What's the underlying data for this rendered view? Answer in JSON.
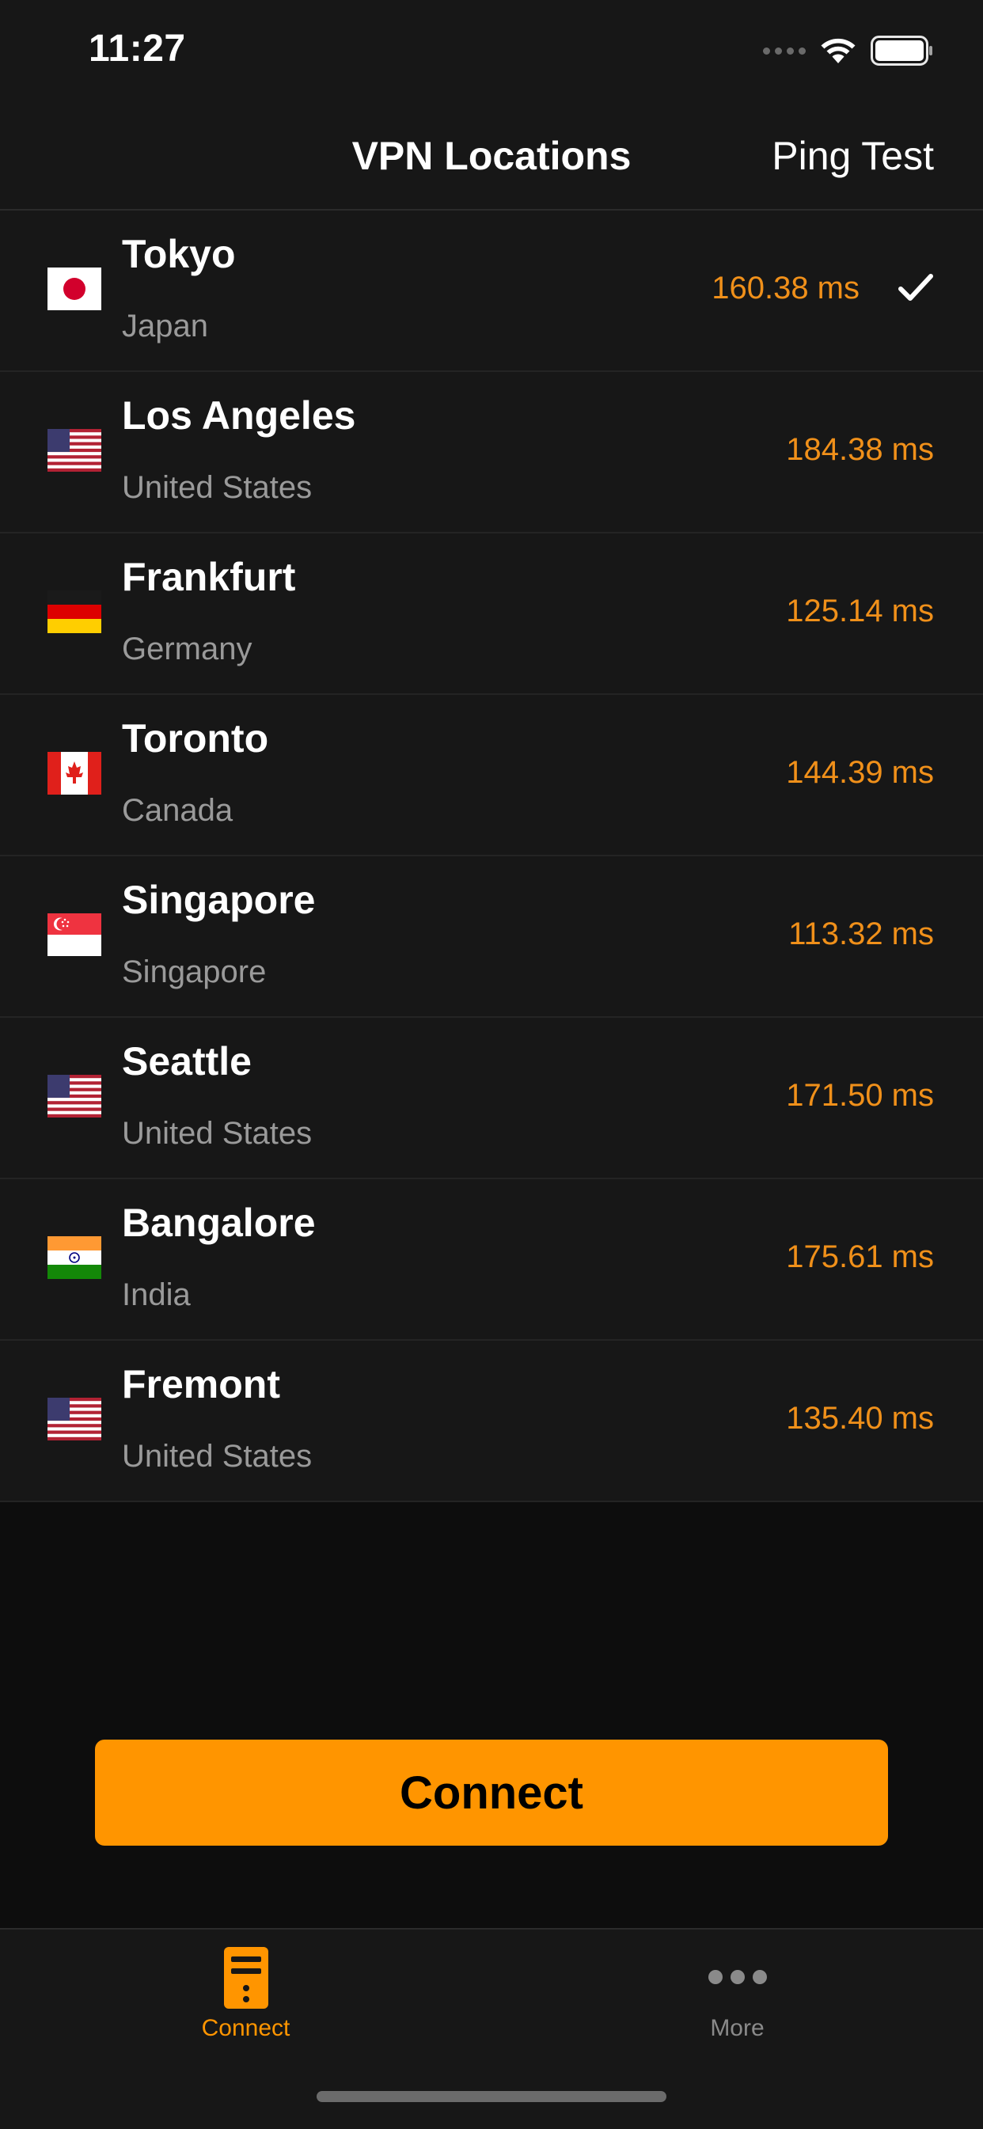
{
  "status_bar": {
    "time": "11:27"
  },
  "nav": {
    "title": "VPN Locations",
    "right_button": "Ping Test"
  },
  "locations": [
    {
      "city": "Tokyo",
      "country": "Japan",
      "ping": "160.38 ms",
      "flag": "japan-flag-icon",
      "selected": true
    },
    {
      "city": "Los Angeles",
      "country": "United States",
      "ping": "184.38 ms",
      "flag": "us-flag-icon",
      "selected": false
    },
    {
      "city": "Frankfurt",
      "country": "Germany",
      "ping": "125.14 ms",
      "flag": "germany-flag-icon",
      "selected": false
    },
    {
      "city": "Toronto",
      "country": "Canada",
      "ping": "144.39 ms",
      "flag": "canada-flag-icon",
      "selected": false
    },
    {
      "city": "Singapore",
      "country": "Singapore",
      "ping": "113.32 ms",
      "flag": "singapore-flag-icon",
      "selected": false
    },
    {
      "city": "Seattle",
      "country": "United States",
      "ping": "171.50 ms",
      "flag": "us-flag-icon",
      "selected": false
    },
    {
      "city": "Bangalore",
      "country": "India",
      "ping": "175.61 ms",
      "flag": "india-flag-icon",
      "selected": false
    },
    {
      "city": "Fremont",
      "country": "United States",
      "ping": "135.40 ms",
      "flag": "us-flag-icon",
      "selected": false
    }
  ],
  "connect_button": {
    "label": "Connect"
  },
  "tabbar": {
    "tabs": [
      {
        "label": "Connect",
        "icon": "server-icon",
        "active": true
      },
      {
        "label": "More",
        "icon": "ellipsis-icon",
        "active": false
      }
    ]
  },
  "colors": {
    "accent": "#ff9500",
    "ping_text": "#f0901a",
    "background": "#0d0d0d",
    "row_background": "#171717",
    "secondary_text": "#9a9a9a"
  }
}
